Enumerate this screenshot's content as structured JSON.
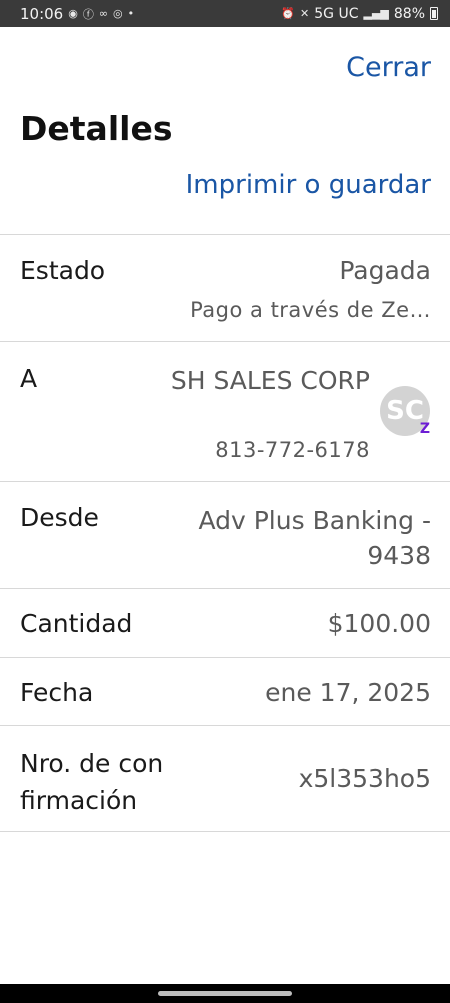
{
  "status_bar": {
    "time": "10:06",
    "network": "5G UC",
    "battery": "88%",
    "left_icons": [
      "messenger-icon",
      "facebook-icon",
      "voicemail-icon",
      "hotspot-icon",
      "dot-icon"
    ],
    "right_icons": [
      "alarm-icon",
      "mute-icon",
      "signal-icon",
      "battery-icon"
    ]
  },
  "header": {
    "close_label": "Cerrar",
    "title": "Detalles",
    "print_label": "Imprimir o guardar"
  },
  "details": {
    "estado": {
      "label": "Estado",
      "value": "Pagada",
      "sub": "Pago a través de Ze…"
    },
    "a": {
      "label": "A",
      "name": "SH SALES CORP",
      "phone": "813-772-6178",
      "avatar_initials": "SC",
      "badge": "Z"
    },
    "desde": {
      "label": "Desde",
      "value": "Adv Plus Banking - 9438"
    },
    "cantidad": {
      "label": "Cantidad",
      "value": "$100.00"
    },
    "fecha": {
      "label": "Fecha",
      "value": "ene 17, 2025"
    },
    "confirmacion": {
      "label": "Nro. de con firmación",
      "value": "x5l353ho5"
    }
  },
  "colors": {
    "link": "#1a56a5",
    "zelle": "#6d1ed4",
    "status_bar_bg": "#3a3a3a"
  }
}
